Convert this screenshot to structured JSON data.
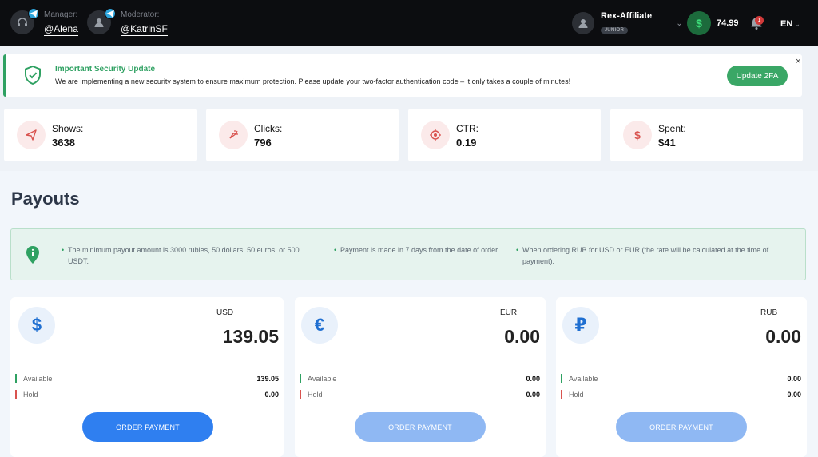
{
  "header": {
    "manager": {
      "role": "Manager:",
      "handle": "@Alena"
    },
    "moderator": {
      "role": "Moderator:",
      "handle": "@KatrinSF"
    },
    "account": {
      "name": "Rex-Affiliate",
      "level": "JUNIOR"
    },
    "balance": "74.99",
    "notifications_count": "1",
    "language": "EN"
  },
  "alert": {
    "title": "Important Security Update",
    "message": "We are implementing a new security system to ensure maximum protection. Please update your two-factor authentication code – it only takes a couple of minutes!",
    "button_label": "Update 2FA",
    "close_label": "×"
  },
  "stats": [
    {
      "label": "Shows:",
      "value": "3638",
      "icon": "send-icon"
    },
    {
      "label": "Clicks:",
      "value": "796",
      "icon": "click-icon"
    },
    {
      "label": "CTR:",
      "value": "0.19",
      "icon": "target-icon"
    },
    {
      "label": "Spent:",
      "value": "$41",
      "icon": "dollar-icon"
    }
  ],
  "payouts": {
    "title": "Payouts",
    "info": [
      "The minimum payout amount is 3000 rubles, 50 dollars, 50 euros, or 500 USDT.",
      "Payment is made in 7 days from the date of order.",
      "When ordering RUB for USD or EUR (the rate will be calculated at the time of payment)."
    ],
    "cards": [
      {
        "currency": "USD",
        "symbol": "$",
        "amount": "139.05",
        "available_label": "Available",
        "available": "139.05",
        "hold_label": "Hold",
        "hold": "0.00",
        "button": "ORDER PAYMENT"
      },
      {
        "currency": "EUR",
        "symbol": "€",
        "amount": "0.00",
        "available_label": "Available",
        "available": "0.00",
        "hold_label": "Hold",
        "hold": "0.00",
        "button": "ORDER PAYMENT"
      },
      {
        "currency": "RUB",
        "symbol": "₽",
        "amount": "0.00",
        "available_label": "Available",
        "available": "0.00",
        "hold_label": "Hold",
        "hold": "0.00",
        "button": "ORDER PAYMENT"
      }
    ]
  },
  "colors": {
    "accent_green": "#2fa162",
    "accent_blue": "#2f7ff0",
    "available_bar": "#2fa162",
    "hold_bar": "#d9534f"
  }
}
